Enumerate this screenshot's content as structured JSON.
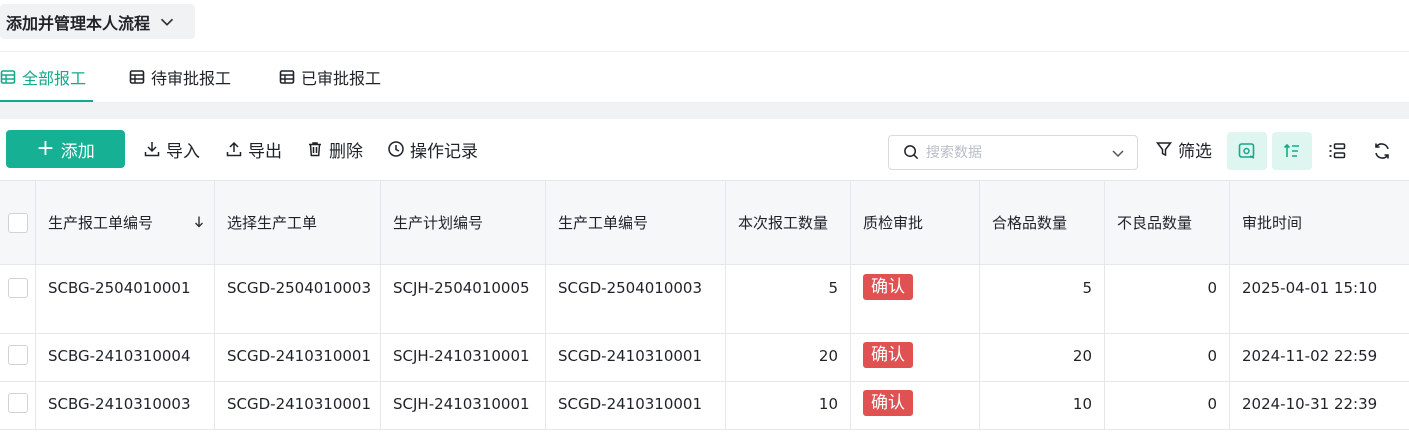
{
  "header": {
    "title": "添加并管理本人流程"
  },
  "tabs": [
    {
      "label": "全部报工",
      "active": true
    },
    {
      "label": "待审批报工",
      "active": false
    },
    {
      "label": "已审批报工",
      "active": false
    }
  ],
  "toolbar": {
    "add_label": "添加",
    "import_label": "导入",
    "export_label": "导出",
    "delete_label": "删除",
    "log_label": "操作记录",
    "search_placeholder": "搜索数据",
    "filter_label": "筛选"
  },
  "colors": {
    "accent": "#16b094",
    "badge": "#e05252"
  },
  "table": {
    "columns": [
      "生产报工单编号",
      "选择生产工单",
      "生产计划编号",
      "生产工单编号",
      "本次报工数量",
      "质检审批",
      "合格品数量",
      "不良品数量",
      "审批时间"
    ],
    "rows": [
      {
        "report_no": "SCBG-2504010001",
        "work_order": "SCGD-2504010003",
        "plan_no": "SCJH-2504010005",
        "order_no": "SCGD-2504010003",
        "qty": "5",
        "approval": "确认",
        "good_qty": "5",
        "bad_qty": "0",
        "time": "2025-04-01 15:10"
      },
      {
        "report_no": "SCBG-2410310004",
        "work_order": "SCGD-2410310001",
        "plan_no": "SCJH-2410310001",
        "order_no": "SCGD-2410310001",
        "qty": "20",
        "approval": "确认",
        "good_qty": "20",
        "bad_qty": "0",
        "time": "2024-11-02 22:59"
      },
      {
        "report_no": "SCBG-2410310003",
        "work_order": "SCGD-2410310001",
        "plan_no": "SCJH-2410310001",
        "order_no": "SCGD-2410310001",
        "qty": "10",
        "approval": "确认",
        "good_qty": "10",
        "bad_qty": "0",
        "time": "2024-10-31 22:39"
      }
    ]
  }
}
